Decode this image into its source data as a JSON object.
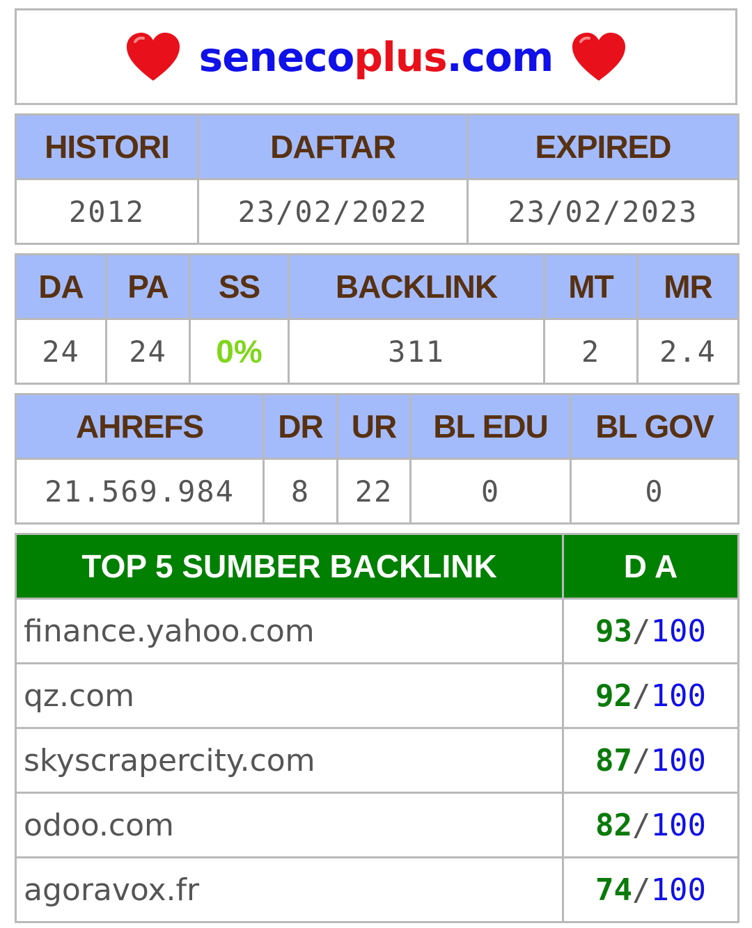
{
  "site": {
    "part1": "seneco",
    "part2": "plus",
    "part3": ".com"
  },
  "colors": {
    "header_bg": "#a4bbfb",
    "header_text": "#573112",
    "green_header": "#008000",
    "heart": "#e8101a",
    "blue": "#1010e8",
    "ss_green": "#7fd61a"
  },
  "domain_info": {
    "headers": [
      "HISTORI",
      "DAFTAR",
      "EXPIRED"
    ],
    "values": [
      "2012",
      "23/02/2022",
      "23/02/2023"
    ]
  },
  "moz": {
    "headers": [
      "DA",
      "PA",
      "SS",
      "BACKLINK",
      "MT",
      "MR"
    ],
    "values": [
      "24",
      "24",
      "0%",
      "311",
      "2",
      "2.4"
    ]
  },
  "ahrefs": {
    "headers": [
      "AHREFS",
      "DR",
      "UR",
      "BL EDU",
      "BL GOV"
    ],
    "values": [
      "21.569.984",
      "8",
      "22",
      "0",
      "0"
    ]
  },
  "backlinks": {
    "header_site": "TOP 5 SUMBER BACKLINK",
    "header_da": "D A",
    "rows": [
      {
        "site": "finance.yahoo.com",
        "score": "93",
        "sep": "/",
        "max": "100"
      },
      {
        "site": "qz.com",
        "score": "92",
        "sep": "/",
        "max": "100"
      },
      {
        "site": "skyscrapercity.com",
        "score": "87",
        "sep": "/",
        "max": "100"
      },
      {
        "site": "odoo.com",
        "score": "82",
        "sep": "/",
        "max": "100"
      },
      {
        "site": "agoravox.fr",
        "score": "74",
        "sep": "/",
        "max": "100"
      }
    ]
  }
}
